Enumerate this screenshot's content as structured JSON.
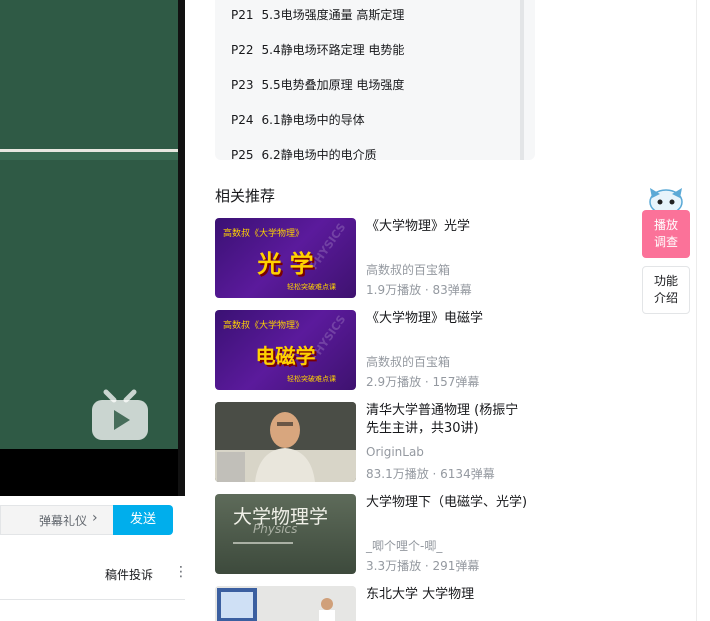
{
  "player": {
    "danmaku_etiquette": "弹幕礼仪",
    "send_label": "发送"
  },
  "toolbar": {
    "complain_label": "稿件投诉",
    "more_icon": "more-vertical-icon"
  },
  "episodes": [
    {
      "num": "P21",
      "title": "5.3电场强度通量 高斯定理"
    },
    {
      "num": "P22",
      "title": "5.4静电场环路定理 电势能"
    },
    {
      "num": "P23",
      "title": "5.5电势叠加原理 电场强度"
    },
    {
      "num": "P24",
      "title": "6.1静电场中的导体"
    },
    {
      "num": "P25",
      "title": "6.2静电场中的电介质"
    }
  ],
  "related": {
    "heading": "相关推荐",
    "items": [
      {
        "title": "《大学物理》光学",
        "up": "高数叔的百宝箱",
        "stats": "1.9万播放 · 83弹幕",
        "thumb_text": "光 学",
        "thumb_top": "高数叔《大学物理》",
        "thumb_bottom": "轻松突破难点课",
        "thumb_wm": "PHYSICS"
      },
      {
        "title": "《大学物理》电磁学",
        "up": "高数叔的百宝箱",
        "stats": "2.9万播放 · 157弹幕",
        "thumb_text": "电磁学",
        "thumb_top": "高数叔《大学物理》",
        "thumb_bottom": "轻松突破难点课",
        "thumb_wm": "PHYSICS"
      },
      {
        "title": "清华大学普通物理 (杨振宁先生主讲，共30讲)",
        "up": "OriginLab",
        "stats": "83.1万播放 · 6134弹幕"
      },
      {
        "title": "大学物理下（电磁学、光学)",
        "up": "_唧个哩个-唧_",
        "stats": "3.3万播放 · 291弹幕",
        "thumb_text": "大学物理学",
        "thumb_sub": "Physics"
      },
      {
        "title": "东北大学 大学物理",
        "up": "",
        "stats": ""
      }
    ]
  },
  "widgets": {
    "survey_label_1": "播放",
    "survey_label_2": "调查",
    "feature_label_1": "功能",
    "feature_label_2": "介绍"
  },
  "colors": {
    "accent_blue": "#00aeec",
    "accent_pink": "#fb7299"
  }
}
